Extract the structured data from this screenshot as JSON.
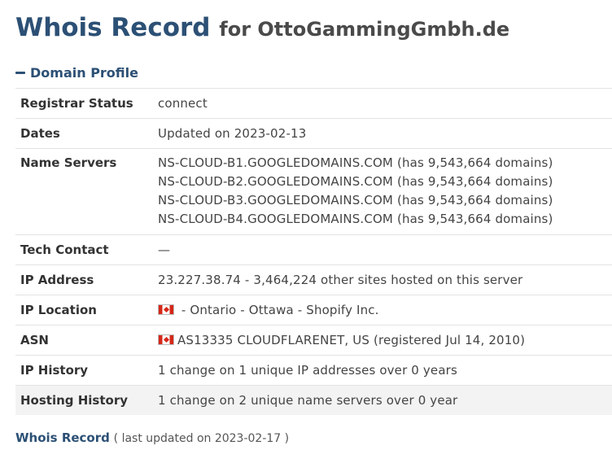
{
  "header": {
    "title_main": "Whois Record",
    "title_for": "for OttoGammingGmbh.de"
  },
  "section": {
    "label": "Domain Profile",
    "toggle_icon": "minus-icon"
  },
  "profile": {
    "registrar_status": {
      "label": "Registrar Status",
      "value": "connect"
    },
    "dates": {
      "label": "Dates",
      "value": "Updated on 2023-02-13"
    },
    "name_servers": {
      "label": "Name Servers",
      "servers": [
        "NS-CLOUD-B1.GOOGLEDOMAINS.COM (has 9,543,664 domains)",
        "NS-CLOUD-B2.GOOGLEDOMAINS.COM (has 9,543,664 domains)",
        "NS-CLOUD-B3.GOOGLEDOMAINS.COM (has 9,543,664 domains)",
        "NS-CLOUD-B4.GOOGLEDOMAINS.COM (has 9,543,664 domains)"
      ]
    },
    "tech_contact": {
      "label": "Tech Contact",
      "value": "—"
    },
    "ip_address": {
      "label": "IP Address",
      "value": "23.227.38.74 - 3,464,224 other sites hosted on this server"
    },
    "ip_location": {
      "label": "IP Location",
      "value": "- Ontario - Ottawa - Shopify Inc.",
      "flag_icon": "canada-flag-icon"
    },
    "asn": {
      "label": "ASN",
      "value": "AS13335 CLOUDFLARENET, US (registered Jul 14, 2010)",
      "flag_icon": "canada-flag-icon"
    },
    "ip_history": {
      "label": "IP History",
      "value": "1 change on 1 unique IP addresses over 0 years"
    },
    "hosting_history": {
      "label": "Hosting History",
      "value": "1 change on 2 unique name servers over 0 year"
    }
  },
  "footer": {
    "link_label": "Whois Record",
    "note": "( last updated on 2023-02-17 )"
  },
  "colors": {
    "heading": "#2c5075",
    "row_border": "#e2e2e2",
    "highlight_row": "#f3f3f3"
  }
}
